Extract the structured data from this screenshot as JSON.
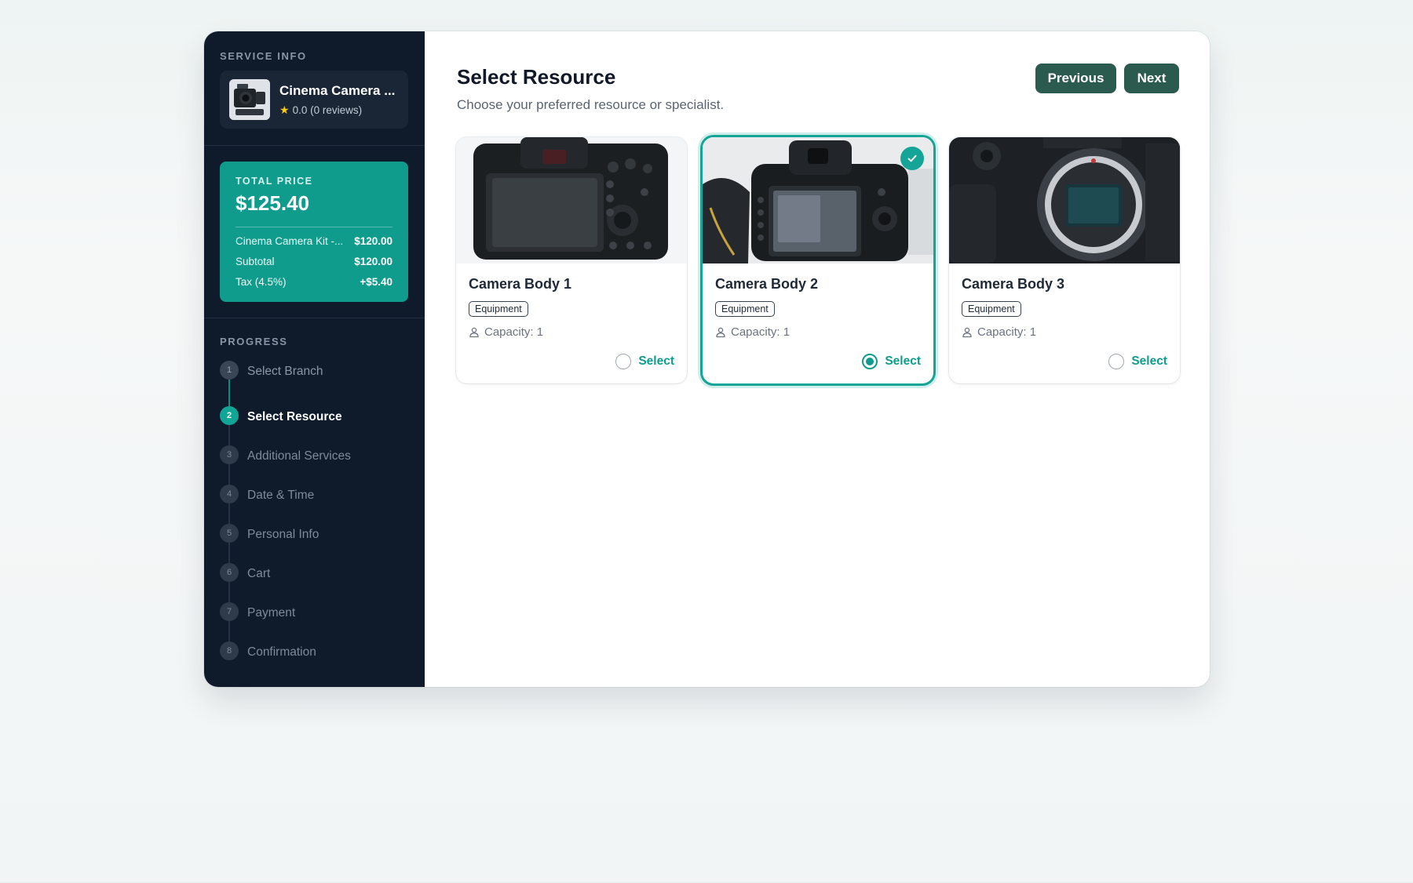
{
  "sidebar": {
    "service_info_label": "SERVICE INFO",
    "service": {
      "name": "Cinema Camera ...",
      "rating": "0.0 (0 reviews)"
    },
    "price": {
      "label": "TOTAL PRICE",
      "total": "$125.40",
      "rows": [
        {
          "label": "Cinema Camera Kit -...",
          "value": "$120.00"
        },
        {
          "label": "Subtotal",
          "value": "$120.00"
        },
        {
          "label": "Tax (4.5%)",
          "value": "+$5.40"
        }
      ]
    },
    "progress_label": "PROGRESS",
    "steps": [
      {
        "num": "1",
        "label": "Select Branch",
        "state": "done"
      },
      {
        "num": "2",
        "label": "Select Resource",
        "state": "active"
      },
      {
        "num": "3",
        "label": "Additional Services",
        "state": "upcoming"
      },
      {
        "num": "4",
        "label": "Date & Time",
        "state": "upcoming"
      },
      {
        "num": "5",
        "label": "Personal Info",
        "state": "upcoming"
      },
      {
        "num": "6",
        "label": "Cart",
        "state": "upcoming"
      },
      {
        "num": "7",
        "label": "Payment",
        "state": "upcoming"
      },
      {
        "num": "8",
        "label": "Confirmation",
        "state": "upcoming"
      }
    ]
  },
  "main": {
    "title": "Select Resource",
    "subtitle": "Choose your preferred resource or specialist.",
    "previous_label": "Previous",
    "next_label": "Next",
    "resources": [
      {
        "name": "Camera Body 1",
        "tag": "Equipment",
        "capacity": "Capacity: 1",
        "select_label": "Select",
        "selected": false
      },
      {
        "name": "Camera Body 2",
        "tag": "Equipment",
        "capacity": "Capacity: 1",
        "select_label": "Select",
        "selected": true
      },
      {
        "name": "Camera Body 3",
        "tag": "Equipment",
        "capacity": "Capacity: 1",
        "select_label": "Select",
        "selected": false
      }
    ]
  },
  "colors": {
    "sidebar_bg": "#0f1b2b",
    "accent": "#0f9c8c",
    "button": "#2b5a4f"
  }
}
